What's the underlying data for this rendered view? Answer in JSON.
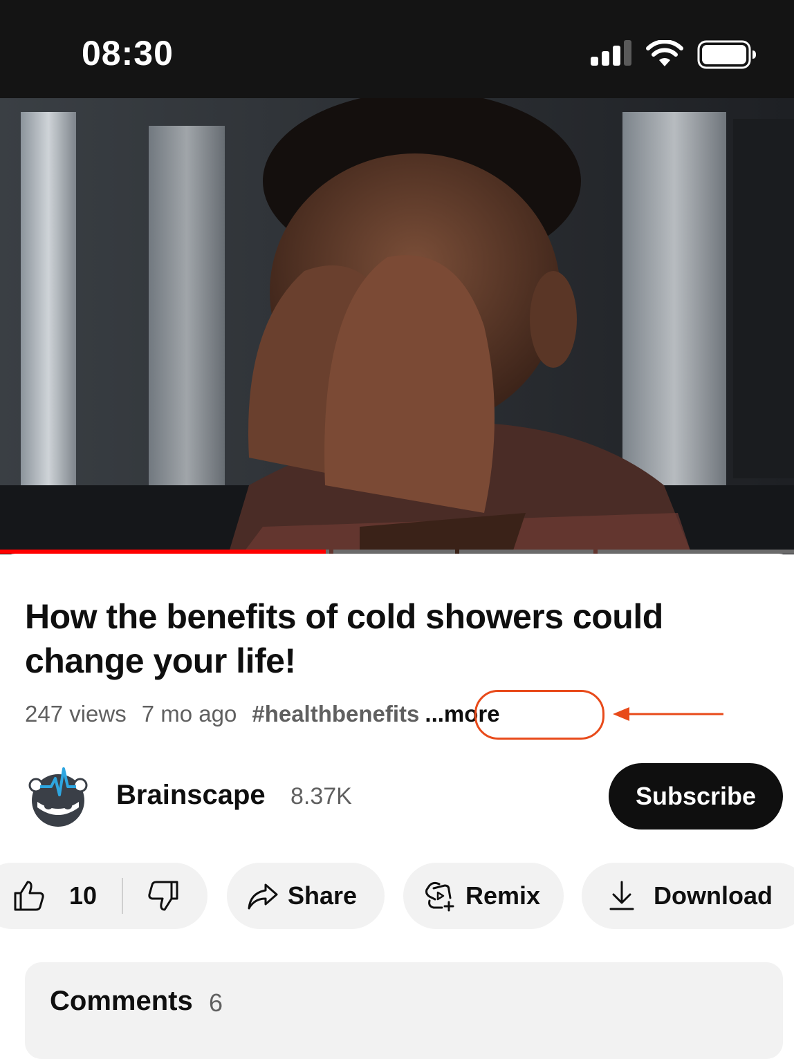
{
  "status_bar": {
    "time": "08:30",
    "icons": [
      "cellular-signal-icon",
      "wifi-icon",
      "battery-icon"
    ]
  },
  "video": {
    "thumbnail": "person-covering-face-icon",
    "progress_fraction": 0.41
  },
  "details": {
    "title": "How the benefits of cold showers could change your life!",
    "views": "247 views",
    "age": "7 mo ago",
    "hashtag": "#healthbenefits",
    "more_label": "...more"
  },
  "channel": {
    "name": "Brainscape",
    "subscribers": "8.37K",
    "subscribe_label": "Subscribe"
  },
  "actions": {
    "like_count": "10",
    "share_label": "Share",
    "remix_label": "Remix",
    "download_label": "Download"
  },
  "comments": {
    "label": "Comments",
    "count": "6"
  },
  "colors": {
    "accent_red": "#ff0000",
    "annotation": "#e84a1a",
    "button_dark": "#0f0f0f",
    "pill_bg": "#f2f2f2",
    "secondary_text": "#606060"
  }
}
